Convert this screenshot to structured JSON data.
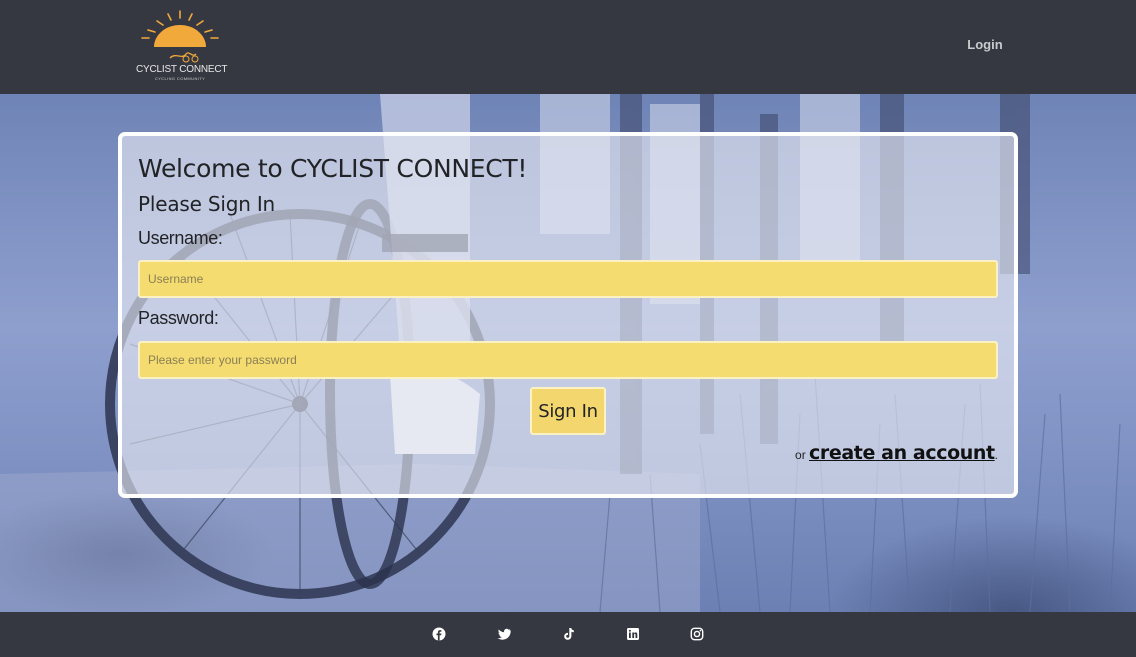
{
  "header": {
    "logo_text": "CYCLIST CONNECT",
    "logo_subtext": "CYCLING COMMUNITY",
    "login_label": "Login"
  },
  "form": {
    "title": "Welcome to CYCLIST CONNECT!",
    "subtitle": "Please Sign In",
    "username_label": "Username:",
    "username_placeholder": "Username",
    "username_value": "",
    "password_label": "Password:",
    "password_placeholder": "Please enter your password",
    "password_value": "",
    "signin_label": "Sign In",
    "or_text": "or",
    "create_account_label": "create an account",
    "trailing_period": "."
  },
  "footer": {
    "social_icons": [
      "facebook-icon",
      "twitter-icon",
      "tiktok-icon",
      "linkedin-icon",
      "instagram-icon"
    ]
  },
  "colors": {
    "header_bg": "#353840",
    "input_bg": "#f5dc70",
    "logo_sun": "#f2a93b",
    "hero_tint": "#8e9fce"
  }
}
